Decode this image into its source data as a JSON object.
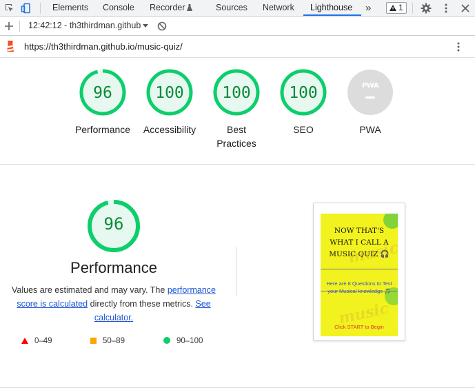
{
  "devtools": {
    "tabs": [
      {
        "label": "Elements"
      },
      {
        "label": "Console"
      },
      {
        "label": "Recorder"
      },
      {
        "label": "Sources"
      },
      {
        "label": "Network"
      },
      {
        "label": "Lighthouse",
        "active": true
      }
    ],
    "more_tabs": "»",
    "warning_count": "1",
    "icons": [
      "inspect-icon",
      "device-toggle-icon",
      "flask-icon",
      "warning-icon",
      "settings-gear-icon",
      "more-vert-icon",
      "close-icon"
    ]
  },
  "lighthouse_toolbar": {
    "report_selector": "12:42:12 - th3thirdman.github",
    "icons": [
      "add-icon",
      "chevron-down-icon",
      "clear-icon"
    ]
  },
  "url_bar": {
    "url": "https://th3thirdman.github.io/music-quiz/",
    "icons": [
      "lighthouse-logo",
      "more-vert-icon"
    ]
  },
  "scores": [
    {
      "label": "Performance",
      "value": "96"
    },
    {
      "label": "Accessibility",
      "value": "100"
    },
    {
      "label": "Best\nPractices",
      "value": "100"
    },
    {
      "label": "SEO",
      "value": "100"
    },
    {
      "label": "PWA",
      "value": "PWA",
      "not_applicable": true
    }
  ],
  "performance": {
    "score": "96",
    "score_fraction": 0.96,
    "title": "Performance",
    "desc_prefix": "Values are estimated and may vary. The ",
    "desc_link1": "performance score is calculated",
    "desc_mid": " directly from these metrics. ",
    "desc_link2": "See calculator.",
    "legend": [
      {
        "range": "0–49",
        "shape": "triangle",
        "color": "#ff0000"
      },
      {
        "range": "50–89",
        "shape": "square",
        "color": "#ffa400"
      },
      {
        "range": "90–100",
        "shape": "circle",
        "color": "#0cce6b"
      }
    ]
  },
  "screenshot": {
    "title": "NOW THAT'S WHAT I CALL A MUSIC QUIZ 🎧",
    "subtitle": "Here are 8 Questions to Test your Musical knowledge 🎵",
    "cta": "Click START to Begin",
    "bg_text": "music"
  },
  "colors": {
    "pass": "#0cce6b",
    "pass_fill": "#e6f8ef",
    "pass_text": "#0b8a3a",
    "na": "#dcdcdc",
    "link": "#1a55d4",
    "accent": "#1a73e8"
  }
}
